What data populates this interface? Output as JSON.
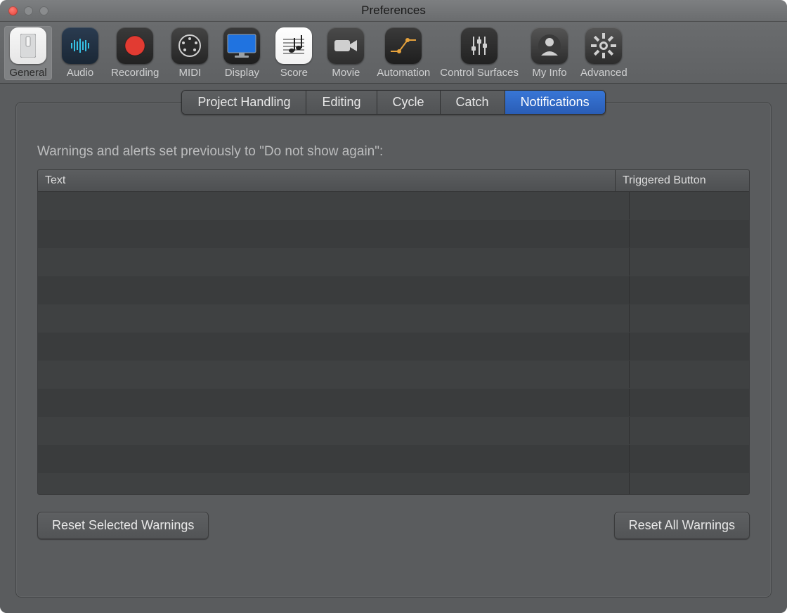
{
  "window": {
    "title": "Preferences"
  },
  "toolbar": {
    "items": [
      {
        "label": "General",
        "selected": true
      },
      {
        "label": "Audio",
        "selected": false
      },
      {
        "label": "Recording",
        "selected": false
      },
      {
        "label": "MIDI",
        "selected": false
      },
      {
        "label": "Display",
        "selected": false
      },
      {
        "label": "Score",
        "selected": false
      },
      {
        "label": "Movie",
        "selected": false
      },
      {
        "label": "Automation",
        "selected": false
      },
      {
        "label": "Control Surfaces",
        "selected": false
      },
      {
        "label": "My Info",
        "selected": false
      },
      {
        "label": "Advanced",
        "selected": false
      }
    ]
  },
  "tabs": {
    "items": [
      {
        "label": "Project Handling",
        "active": false
      },
      {
        "label": "Editing",
        "active": false
      },
      {
        "label": "Cycle",
        "active": false
      },
      {
        "label": "Catch",
        "active": false
      },
      {
        "label": "Notifications",
        "active": true
      }
    ]
  },
  "section": {
    "description": "Warnings and alerts set previously to \"Do not show again\":"
  },
  "table": {
    "columns": {
      "text": "Text",
      "triggered": "Triggered Button"
    },
    "rows": []
  },
  "buttons": {
    "reset_selected": "Reset Selected Warnings",
    "reset_all": "Reset All Warnings"
  }
}
